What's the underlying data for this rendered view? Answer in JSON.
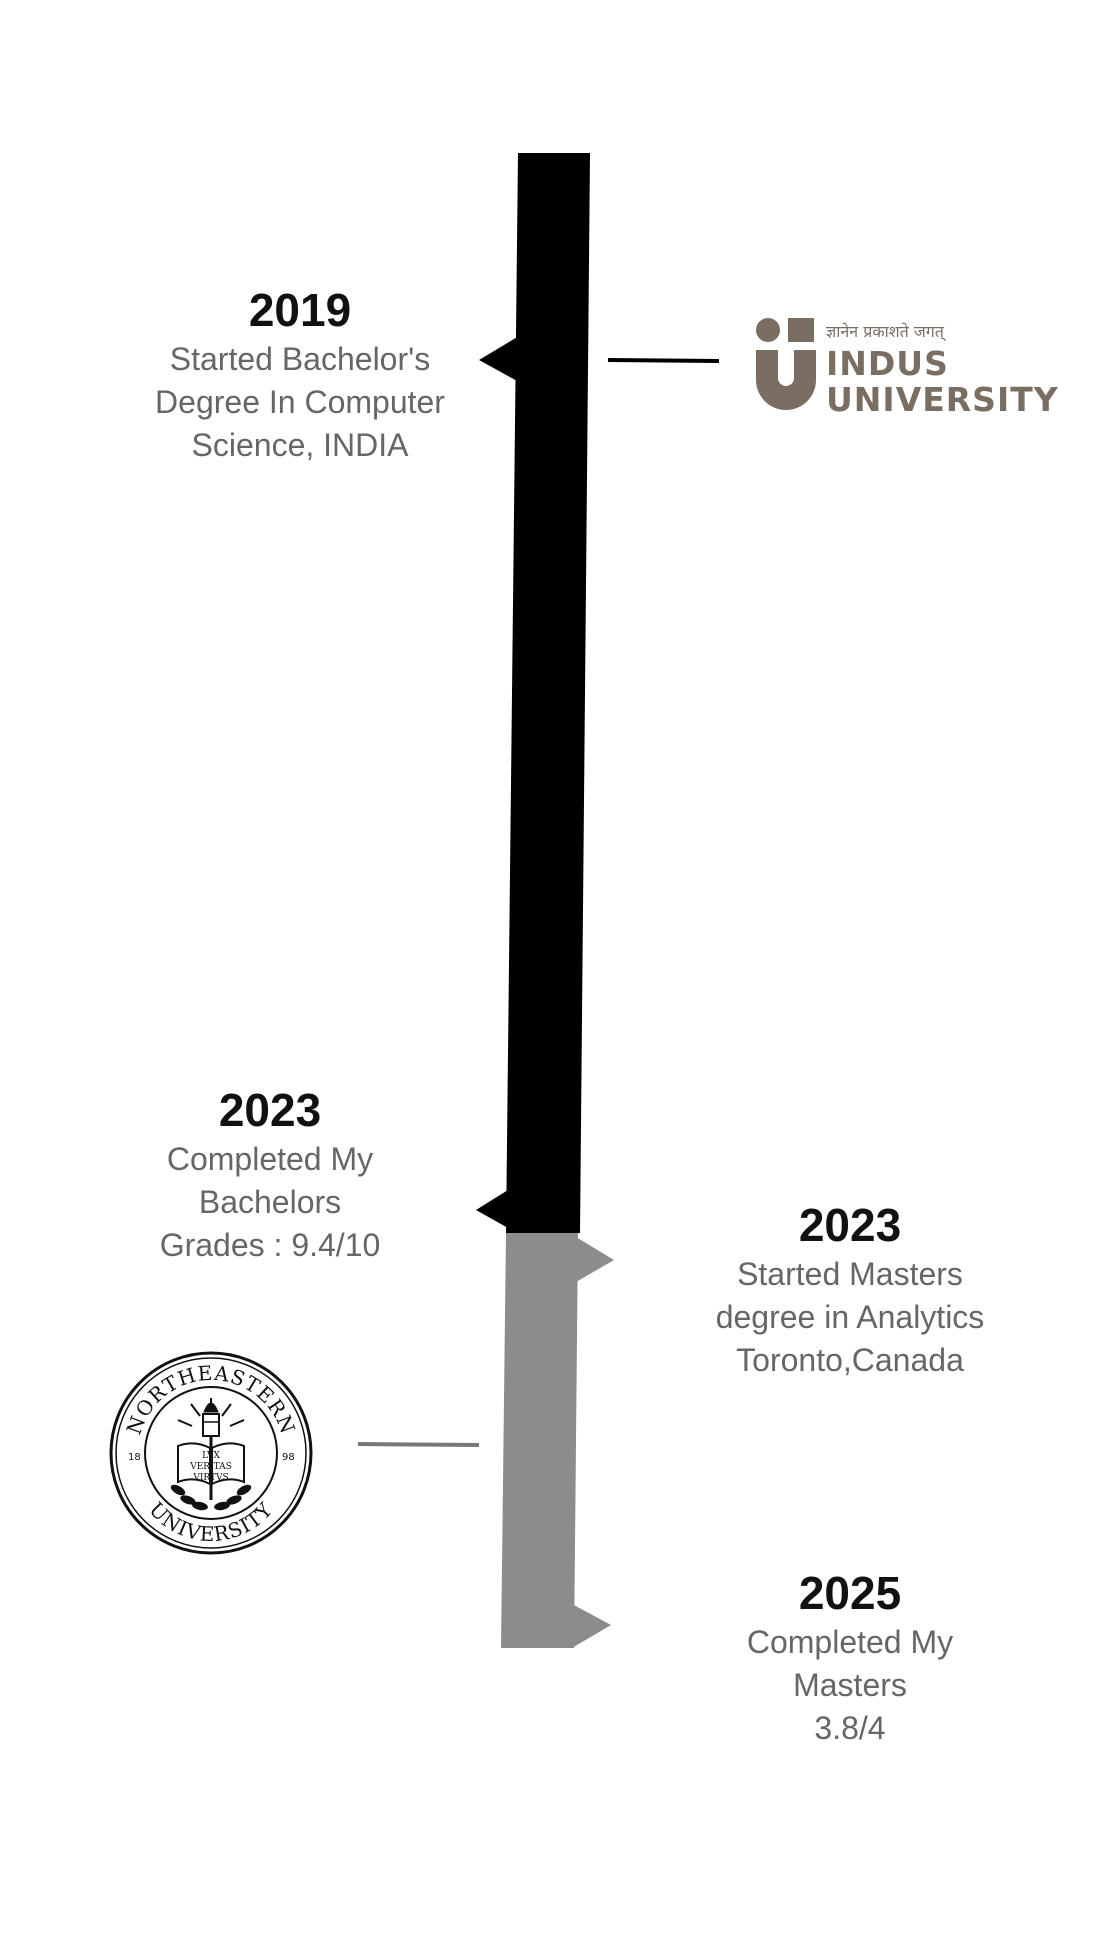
{
  "colors": {
    "bachelors_bar": "#000000",
    "masters_bar": "#8c8c8c",
    "year_text": "#111111",
    "description_text": "#666666",
    "indus_logo": "#7a6e62",
    "connector_bachelors": "#000000",
    "connector_masters": "#777777"
  },
  "events": [
    {
      "year": "2019",
      "lines": [
        "Started Bachelor's",
        "Degree  In Computer",
        "Science, INDIA"
      ]
    },
    {
      "year": "2023",
      "lines": [
        "Completed My",
        "Bachelors",
        "Grades : 9.4/10"
      ]
    },
    {
      "year": "2023",
      "lines": [
        "Started Masters",
        "degree in  Analytics",
        "Toronto,Canada"
      ]
    },
    {
      "year": "2025",
      "lines": [
        "Completed My",
        "Masters",
        "3.8/4"
      ]
    }
  ],
  "logos": {
    "indus": {
      "tagline": "ज्ञानेन प्रकाशते जगत्",
      "line1": "INDUS",
      "line2": "UNIVERSITY"
    },
    "northeastern": {
      "top_text": "NORTHEASTERN",
      "bottom_text": "UNIVERSITY",
      "year_left": "18",
      "year_right": "98",
      "motto_1": "LVX",
      "motto_2": "VERITAS",
      "motto_3": "VIRTVS"
    }
  }
}
